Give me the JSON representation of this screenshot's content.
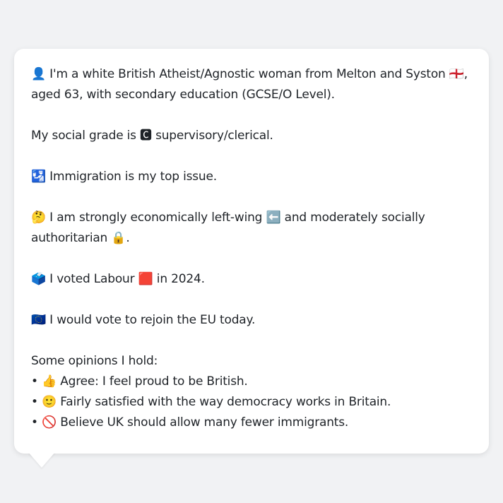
{
  "persona": {
    "intro": {
      "icon": "👤",
      "text_1": " I'm a white British Atheist/Agnostic woman from Melton and Syston ",
      "flag": "🏴󠁧󠁢󠁥󠁮󠁧󠁿",
      "text_2": ", aged 63, with secondary education (GCSE/O Level)."
    },
    "social_grade": {
      "text_1": "My social grade is ",
      "badge": "🅲",
      "text_2": " supervisory/clerical."
    },
    "top_issue": {
      "icon": "🛂",
      "text": " Immigration is my top issue."
    },
    "ideology": {
      "icon": "🤔",
      "text_1": " I am strongly economically left-wing ",
      "left_icon": "⬅️",
      "text_2": " and moderately socially authoritarian ",
      "lock_icon": "🔒",
      "text_3": "."
    },
    "vote_2024": {
      "icon": "🗳️",
      "text_1": " I voted Labour ",
      "party_icon": "🟥",
      "text_2": " in 2024."
    },
    "eu": {
      "icon": "🇪🇺",
      "text": " I would vote to rejoin the EU today."
    },
    "opinions": {
      "heading": "Some opinions I hold:",
      "items": [
        {
          "bullet": "• ",
          "icon": "👍",
          "text": " Agree: I feel proud to be British."
        },
        {
          "bullet": "• ",
          "icon": "🙂",
          "text": " Fairly satisfied with the way democracy works in Britain."
        },
        {
          "bullet": "• ",
          "icon": "🚫",
          "text": " Believe UK should allow many fewer immigrants."
        }
      ]
    }
  }
}
